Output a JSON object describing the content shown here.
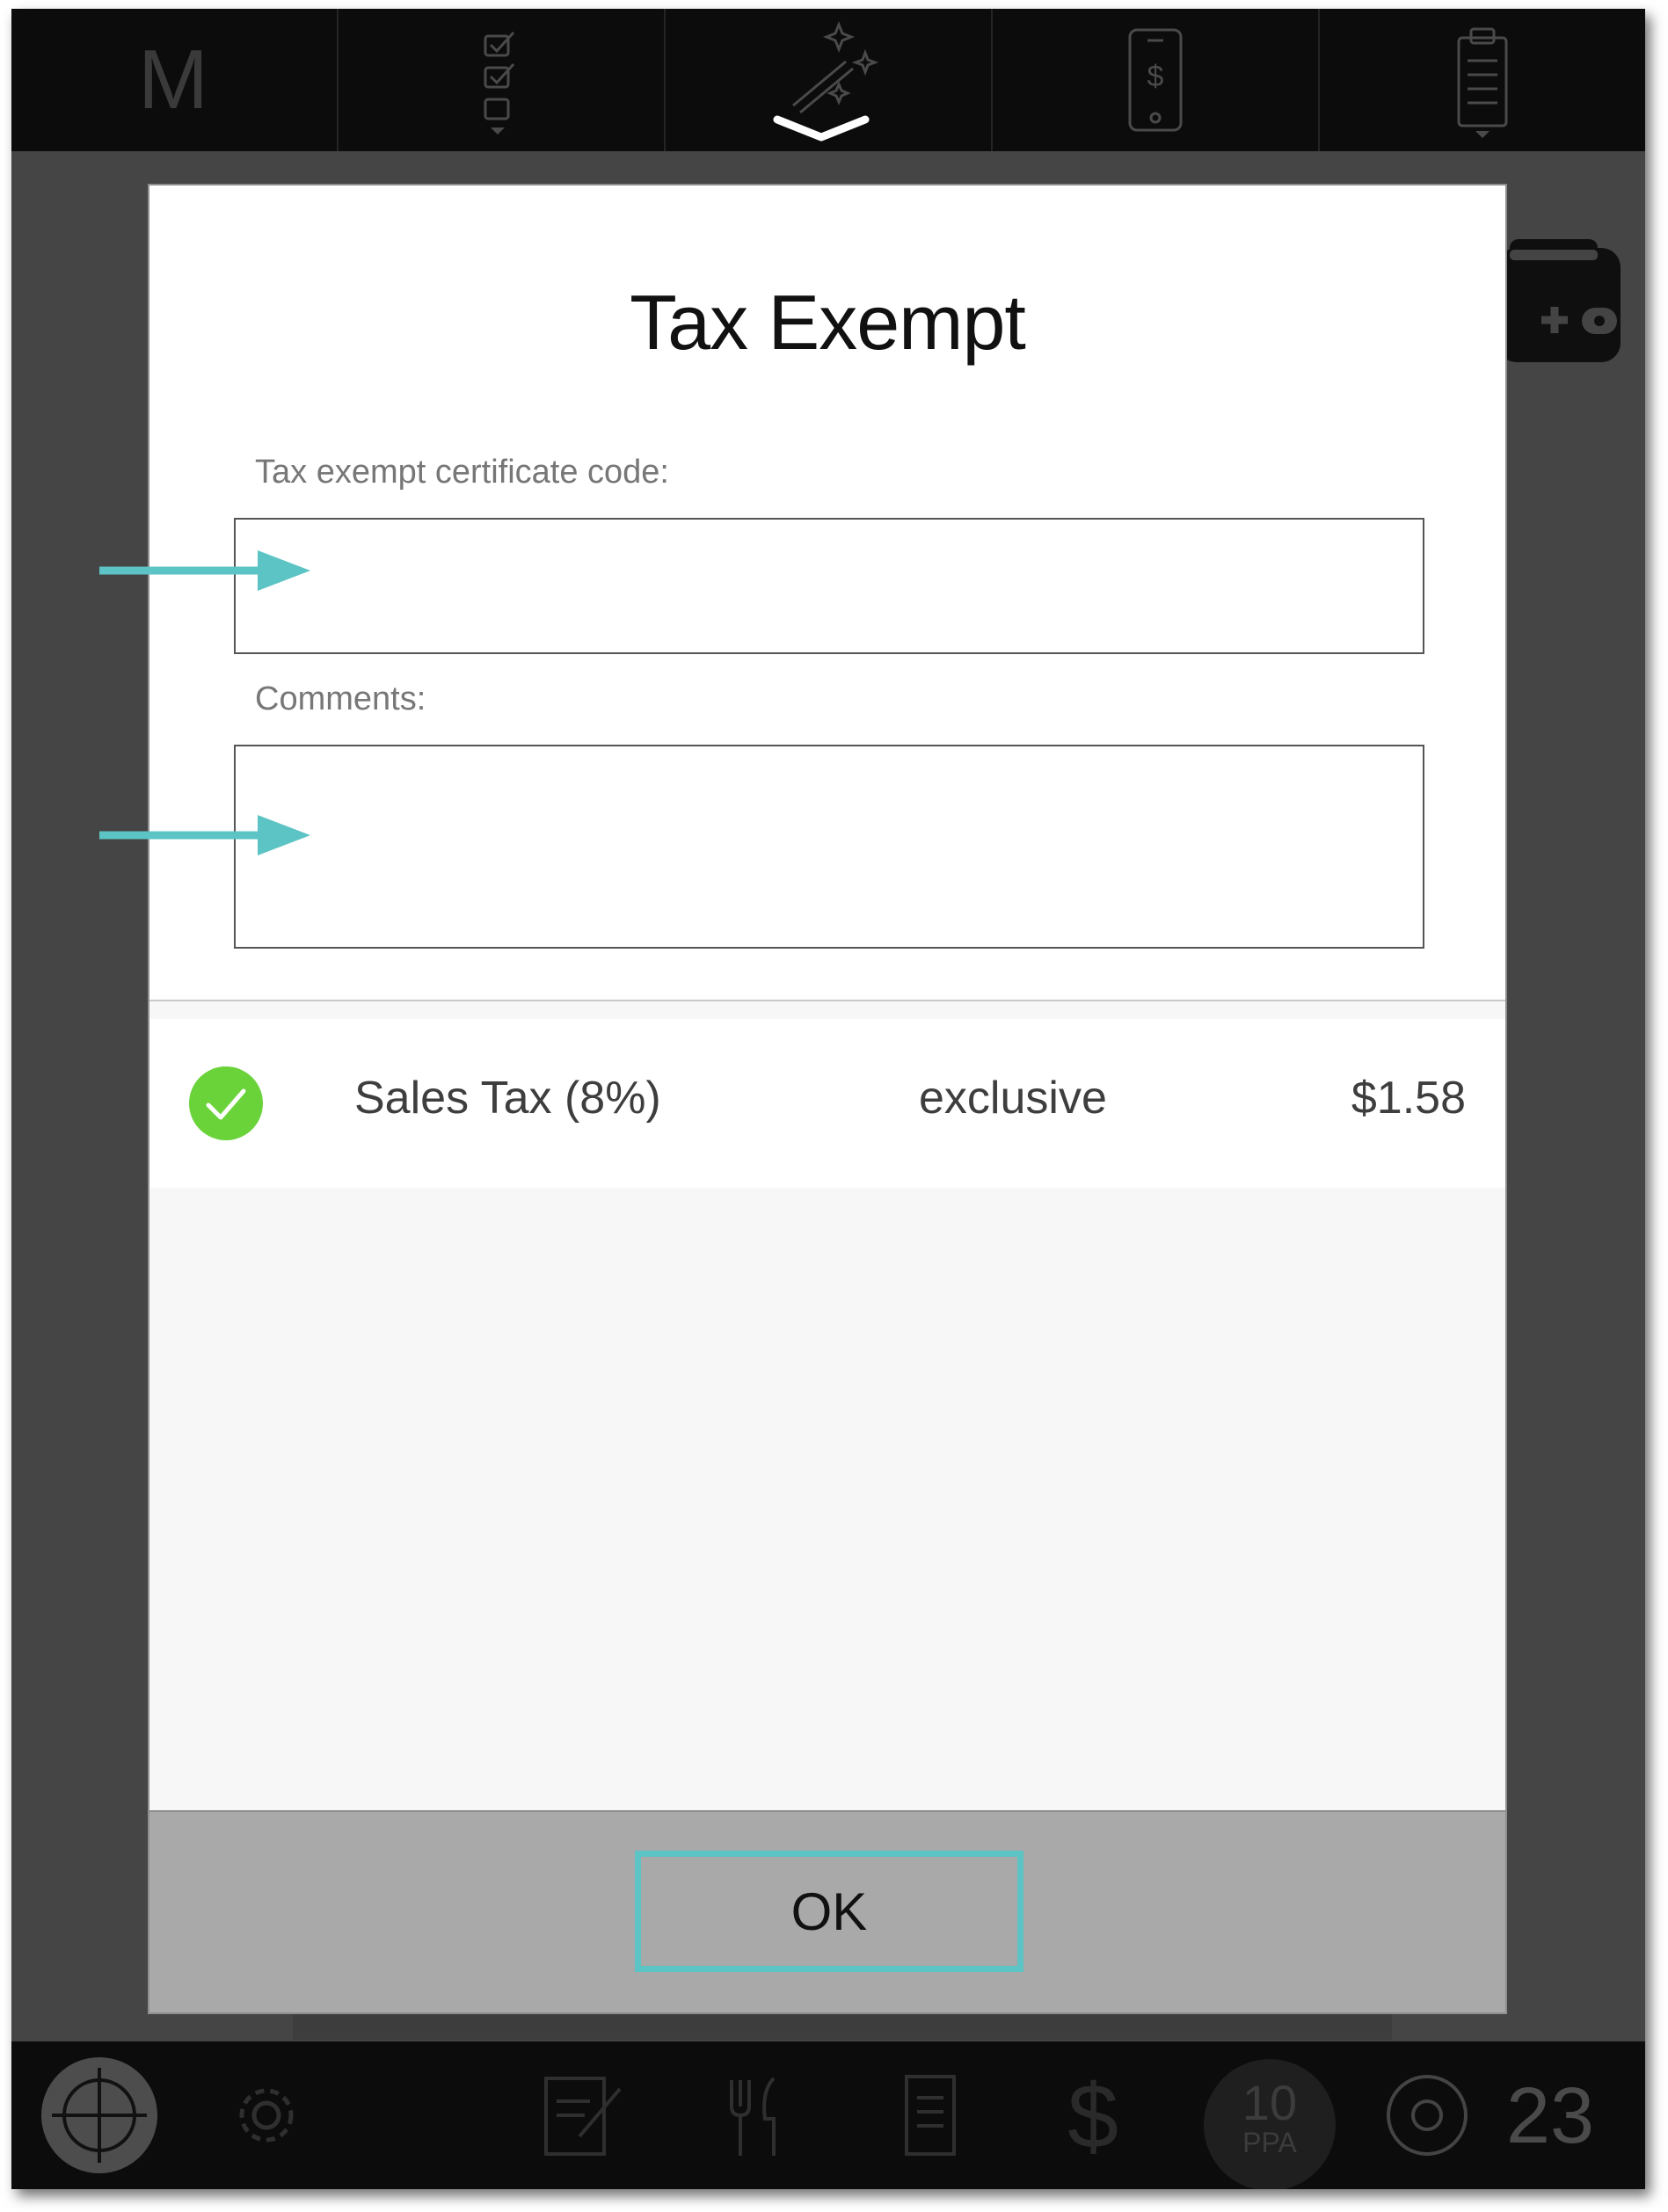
{
  "app": {
    "brand_letter": "M"
  },
  "top_tabs": [
    {
      "name": "checklist-icon"
    },
    {
      "name": "magic-wand-icon"
    },
    {
      "name": "mobile-payment-icon"
    },
    {
      "name": "clipboard-icon"
    }
  ],
  "modal": {
    "title": "Tax Exempt",
    "certificate_label": "Tax exempt certificate code:",
    "certificate_value": "",
    "comments_label": "Comments:",
    "comments_value": "",
    "tax_row": {
      "name": "Sales Tax (8%)",
      "mode": "exclusive",
      "amount": "$1.58",
      "checked": true
    },
    "ok_label": "OK"
  },
  "bottom_bar": {
    "ppa_value": "10",
    "ppa_label": "PPA",
    "count": "23"
  },
  "colors": {
    "accent_teal": "#5cc4c4",
    "check_green": "#6ad33a",
    "bar_black": "#0c0c0c",
    "overlay_gray": "#454545"
  }
}
